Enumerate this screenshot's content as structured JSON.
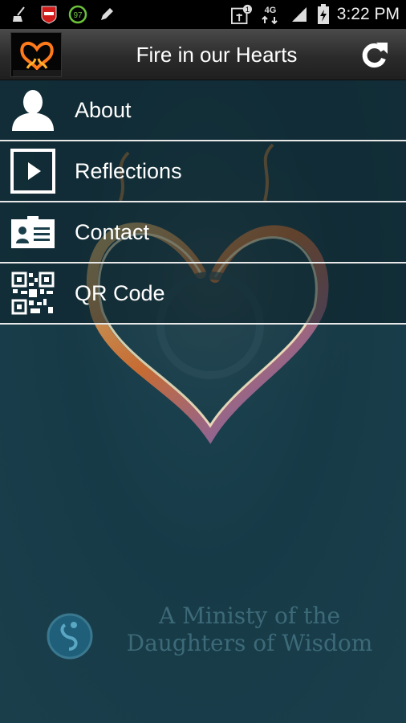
{
  "status_bar": {
    "time": "3:22 PM",
    "network": "4G",
    "badge_count": "97",
    "notification_count": "1",
    "nfl_icon": "nfl-icon"
  },
  "action_bar": {
    "title": "Fire in our Hearts",
    "logo_text": "Fire in our Hearts"
  },
  "menu": {
    "items": [
      {
        "label": "About",
        "icon": "person-icon"
      },
      {
        "label": "Reflections",
        "icon": "play-icon"
      },
      {
        "label": "Contact",
        "icon": "contact-card-icon"
      },
      {
        "label": "QR Code",
        "icon": "qr-code-icon"
      }
    ]
  },
  "footer": {
    "line1": "A Ministy of the",
    "line2": "Daughters of Wisdom"
  },
  "colors": {
    "background": "#173a47",
    "divider": "#e8e8e8",
    "text": "#ffffff"
  }
}
